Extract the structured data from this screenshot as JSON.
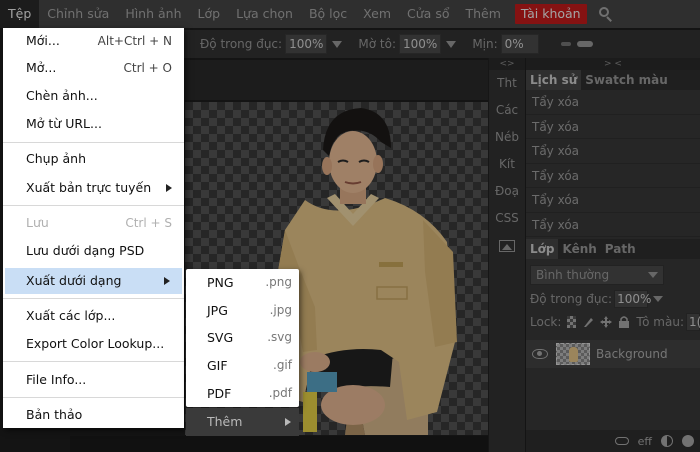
{
  "menubar": {
    "items": [
      "Tệp",
      "Chỉnh sửa",
      "Hình ảnh",
      "Lớp",
      "Lựa chọn",
      "Bộ lọc",
      "Xem",
      "Cửa sổ",
      "Thêm"
    ],
    "account": "Tài khoản",
    "search_icon": "search-icon"
  },
  "options": {
    "opacity_label": "Độ trong đục:",
    "opacity_value": "100%",
    "flow_label": "Mờ tô:",
    "flow_value": "100%",
    "smooth_label": "Mịn:",
    "smooth_value": "0%"
  },
  "tools_column": {
    "collapse": "<>",
    "items": [
      "Tht",
      "Các",
      "Néb",
      "Kít",
      "Đoạ",
      "CSS"
    ],
    "image_icon": "image-icon"
  },
  "panels": {
    "collapse": ">  <",
    "history_tabs": [
      "Lịch sử",
      "Swatch màu"
    ],
    "history_rows": [
      "Tẩy xóa",
      "Tẩy xóa",
      "Tẩy xóa",
      "Tẩy xóa",
      "Tẩy xóa",
      "Tẩy xóa"
    ],
    "layer_tabs": [
      "Lớp",
      "Kênh",
      "Path"
    ],
    "blend_mode": "Bình thường",
    "opacity_label": "Độ trong đục:",
    "opacity_value": "100%",
    "lock_label": "Lock:",
    "fill_label": "Tô màu:",
    "fill_value": "1(",
    "layer_name": "Background",
    "footer": {
      "eff": "eff"
    }
  },
  "file_menu": {
    "items": [
      {
        "label": "Mới...",
        "shortcut": "Alt+Ctrl + N"
      },
      {
        "label": "Mở...",
        "shortcut": "Ctrl + O"
      },
      {
        "label": "Chèn ảnh...",
        "shortcut": ""
      },
      {
        "label": "Mở từ URL...",
        "shortcut": ""
      },
      {
        "label": "Chụp ảnh",
        "shortcut": ""
      },
      {
        "label": "Xuất bản trực tuyến",
        "shortcut": ""
      },
      {
        "label": "Lưu",
        "shortcut": "Ctrl + S"
      },
      {
        "label": "Lưu dưới dạng PSD",
        "shortcut": ""
      },
      {
        "label": "Xuất dưới dạng",
        "shortcut": ""
      },
      {
        "label": "Xuất các lớp...",
        "shortcut": ""
      },
      {
        "label": "Export Color Lookup...",
        "shortcut": ""
      },
      {
        "label": "File Info...",
        "shortcut": ""
      },
      {
        "label": "Bản thảo",
        "shortcut": ""
      }
    ]
  },
  "export_submenu": {
    "items": [
      {
        "label": "PNG",
        "ext": ".png"
      },
      {
        "label": "JPG",
        "ext": ".jpg"
      },
      {
        "label": "SVG",
        "ext": ".svg"
      },
      {
        "label": "GIF",
        "ext": ".gif"
      },
      {
        "label": "PDF",
        "ext": ".pdf"
      }
    ],
    "more": "Thêm"
  },
  "colors": {
    "account_bg": "#c71c1c",
    "highlight": "#c9def5",
    "shirt": "#e7c78a"
  }
}
